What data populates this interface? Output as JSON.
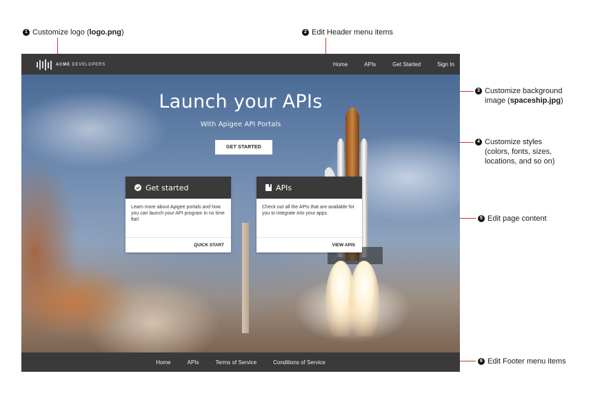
{
  "callouts": [
    {
      "num": "1",
      "text": "Customize logo (",
      "bold": "logo.png",
      "after": ")"
    },
    {
      "num": "2",
      "text": "Edit Header menu items"
    },
    {
      "num": "3",
      "line1": "Customize background",
      "line2": "image (",
      "bold": "spaceship.jpg",
      "after": ")"
    },
    {
      "num": "4",
      "line1": "Customize styles",
      "line2": "(colors, fonts, sizes,",
      "line3": "locations, and so on)"
    },
    {
      "num": "5",
      "text": "Edit page content"
    },
    {
      "num": "6",
      "text": "Edit Footer menu items"
    }
  ],
  "header": {
    "logo": {
      "brand": "ACME",
      "suffix": "DEVELOPERS"
    },
    "nav": [
      "Home",
      "APIs",
      "Get Started",
      "Sign In"
    ]
  },
  "hero": {
    "title": "Launch your APIs",
    "subtitle": "With Apigee API Portals",
    "cta_label": "GET STARTED"
  },
  "cards": [
    {
      "title": "Get started",
      "icon": "check-circle-icon",
      "body": "Learn more about Apigee portals and how you can launch your API program in no time flat!",
      "action": "QUICK START"
    },
    {
      "title": "APIs",
      "icon": "book-icon",
      "body": "Check out all the APIs that are available for you to integrate into your apps.",
      "action": "VIEW APIS"
    }
  ],
  "footer": {
    "links": [
      "Home",
      "APIs",
      "Terms of Service",
      "Conditions of Service"
    ]
  },
  "colors": {
    "bar": "#3a3a3a",
    "leader": "#c0392b",
    "card": "#ffffff"
  }
}
